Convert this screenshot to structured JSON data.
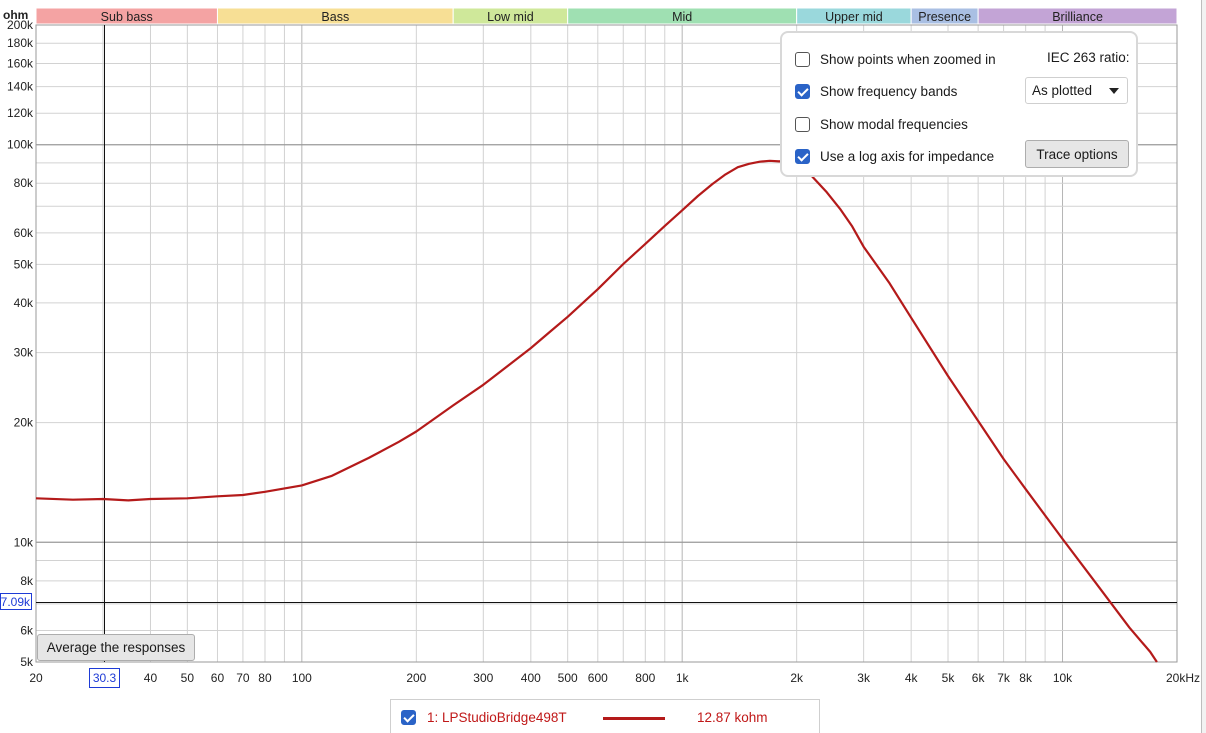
{
  "chart_data": {
    "type": "line",
    "title": "",
    "xlabel": "",
    "ylabel": "ohm",
    "x_unit": "Hz",
    "x_scale": "log",
    "y_scale": "log",
    "xlim": [
      20,
      20000
    ],
    "ylim": [
      5000,
      200000
    ],
    "grid": true,
    "x_tick_labels": [
      {
        "v": 20,
        "t": "20"
      },
      {
        "v": 40,
        "t": "40"
      },
      {
        "v": 50,
        "t": "50"
      },
      {
        "v": 60,
        "t": "60"
      },
      {
        "v": 70,
        "t": "70"
      },
      {
        "v": 80,
        "t": "80"
      },
      {
        "v": 100,
        "t": "100"
      },
      {
        "v": 200,
        "t": "200"
      },
      {
        "v": 300,
        "t": "300"
      },
      {
        "v": 400,
        "t": "400"
      },
      {
        "v": 500,
        "t": "500"
      },
      {
        "v": 600,
        "t": "600"
      },
      {
        "v": 800,
        "t": "800"
      },
      {
        "v": 1000,
        "t": "1k"
      },
      {
        "v": 2000,
        "t": "2k"
      },
      {
        "v": 3000,
        "t": "3k"
      },
      {
        "v": 4000,
        "t": "4k"
      },
      {
        "v": 5000,
        "t": "5k"
      },
      {
        "v": 6000,
        "t": "6k"
      },
      {
        "v": 7000,
        "t": "7k"
      },
      {
        "v": 8000,
        "t": "8k"
      },
      {
        "v": 10000,
        "t": "10k"
      },
      {
        "v": 20000,
        "t": "20kHz"
      }
    ],
    "y_tick_labels": [
      {
        "v": 200000,
        "t": "200k"
      },
      {
        "v": 180000,
        "t": "180k"
      },
      {
        "v": 160000,
        "t": "160k"
      },
      {
        "v": 140000,
        "t": "140k"
      },
      {
        "v": 120000,
        "t": "120k"
      },
      {
        "v": 100000,
        "t": "100k"
      },
      {
        "v": 80000,
        "t": "80k"
      },
      {
        "v": 60000,
        "t": "60k"
      },
      {
        "v": 50000,
        "t": "50k"
      },
      {
        "v": 40000,
        "t": "40k"
      },
      {
        "v": 30000,
        "t": "30k"
      },
      {
        "v": 20000,
        "t": "20k"
      },
      {
        "v": 10000,
        "t": "10k"
      },
      {
        "v": 8000,
        "t": "8k"
      },
      {
        "v": 6000,
        "t": "6k"
      },
      {
        "v": 5000,
        "t": "5k"
      }
    ],
    "bands": [
      {
        "name": "Sub bass",
        "from": 20,
        "to": 60,
        "color": "#f4a3a3"
      },
      {
        "name": "Bass",
        "from": 60,
        "to": 250,
        "color": "#f7df95"
      },
      {
        "name": "Low mid",
        "from": 250,
        "to": 500,
        "color": "#cfe89a"
      },
      {
        "name": "Mid",
        "from": 500,
        "to": 2000,
        "color": "#9fe0b2"
      },
      {
        "name": "Upper mid",
        "from": 2000,
        "to": 4000,
        "color": "#9ad8dc"
      },
      {
        "name": "Presence",
        "from": 4000,
        "to": 6000,
        "color": "#a9bfe3"
      },
      {
        "name": "Brilliance",
        "from": 6000,
        "to": 20000,
        "color": "#c3a4d6"
      }
    ],
    "series": [
      {
        "name": "1: LPStudioBridge498T",
        "color": "#b41a1a",
        "x": [
          20,
          25,
          30,
          35,
          40,
          50,
          60,
          70,
          80,
          100,
          120,
          150,
          180,
          200,
          250,
          300,
          350,
          400,
          450,
          500,
          600,
          700,
          800,
          900,
          1000,
          1100,
          1200,
          1300,
          1400,
          1500,
          1600,
          1700,
          1800,
          1900,
          2000,
          2100,
          2200,
          2400,
          2600,
          2800,
          3000,
          3500,
          4000,
          5000,
          6000,
          7000,
          8000,
          10000,
          12000,
          15000,
          17000,
          20000
        ],
        "y": [
          12900,
          12800,
          12850,
          12750,
          12850,
          12900,
          13050,
          13150,
          13400,
          13900,
          14700,
          16300,
          17900,
          19000,
          22100,
          24900,
          27900,
          30800,
          33900,
          36900,
          43300,
          50100,
          56300,
          62500,
          68400,
          74300,
          79600,
          84200,
          87800,
          89500,
          90600,
          91100,
          90800,
          91400,
          89000,
          86500,
          83100,
          75900,
          69000,
          62300,
          55400,
          45000,
          36700,
          26200,
          20200,
          16200,
          13600,
          10200,
          8100,
          6100,
          5300,
          4200
        ]
      }
    ],
    "cursor": {
      "x_label": "30.3",
      "y_label": "7.09k"
    }
  },
  "options_panel": {
    "show_points_label": "Show points when zoomed in",
    "show_points_checked": false,
    "show_bands_label": "Show frequency bands",
    "show_bands_checked": true,
    "show_modal_label": "Show modal frequencies",
    "show_modal_checked": false,
    "log_axis_label": "Use a log axis for impedance",
    "log_axis_checked": true,
    "iec_label": "IEC 263 ratio:",
    "iec_value": "As plotted",
    "trace_options_label": "Trace options",
    "highlight_color": "#d41818"
  },
  "average_button_label": "Average the responses",
  "legend": {
    "checked": true,
    "name": "1: LPStudioBridge498T",
    "value": "12.87 kohm"
  }
}
